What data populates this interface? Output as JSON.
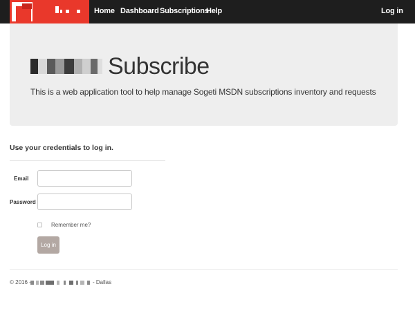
{
  "navbar": {
    "brand_color": "#e9382b",
    "background_color": "#1e1e1e",
    "links": [
      {
        "label": "Home"
      },
      {
        "label": "Dashboard"
      },
      {
        "label": "Subscriptions"
      },
      {
        "label": "Help"
      }
    ],
    "login_label": "Log in"
  },
  "jumbotron": {
    "title": "Subscribe",
    "lead": "This is a web application tool to help manage Sogeti MSDN subscriptions inventory and requests"
  },
  "login_form": {
    "heading": "Use your credentials to log in.",
    "email_label": "Email",
    "email_value": "",
    "password_label": "Password",
    "password_value": "",
    "remember_label": "Remember me?",
    "remember_checked": false,
    "submit_label": "Log in",
    "submit_color": "#b3a8a3"
  },
  "footer": {
    "prefix": "© 2016 -",
    "suffix": "- Dallas"
  }
}
